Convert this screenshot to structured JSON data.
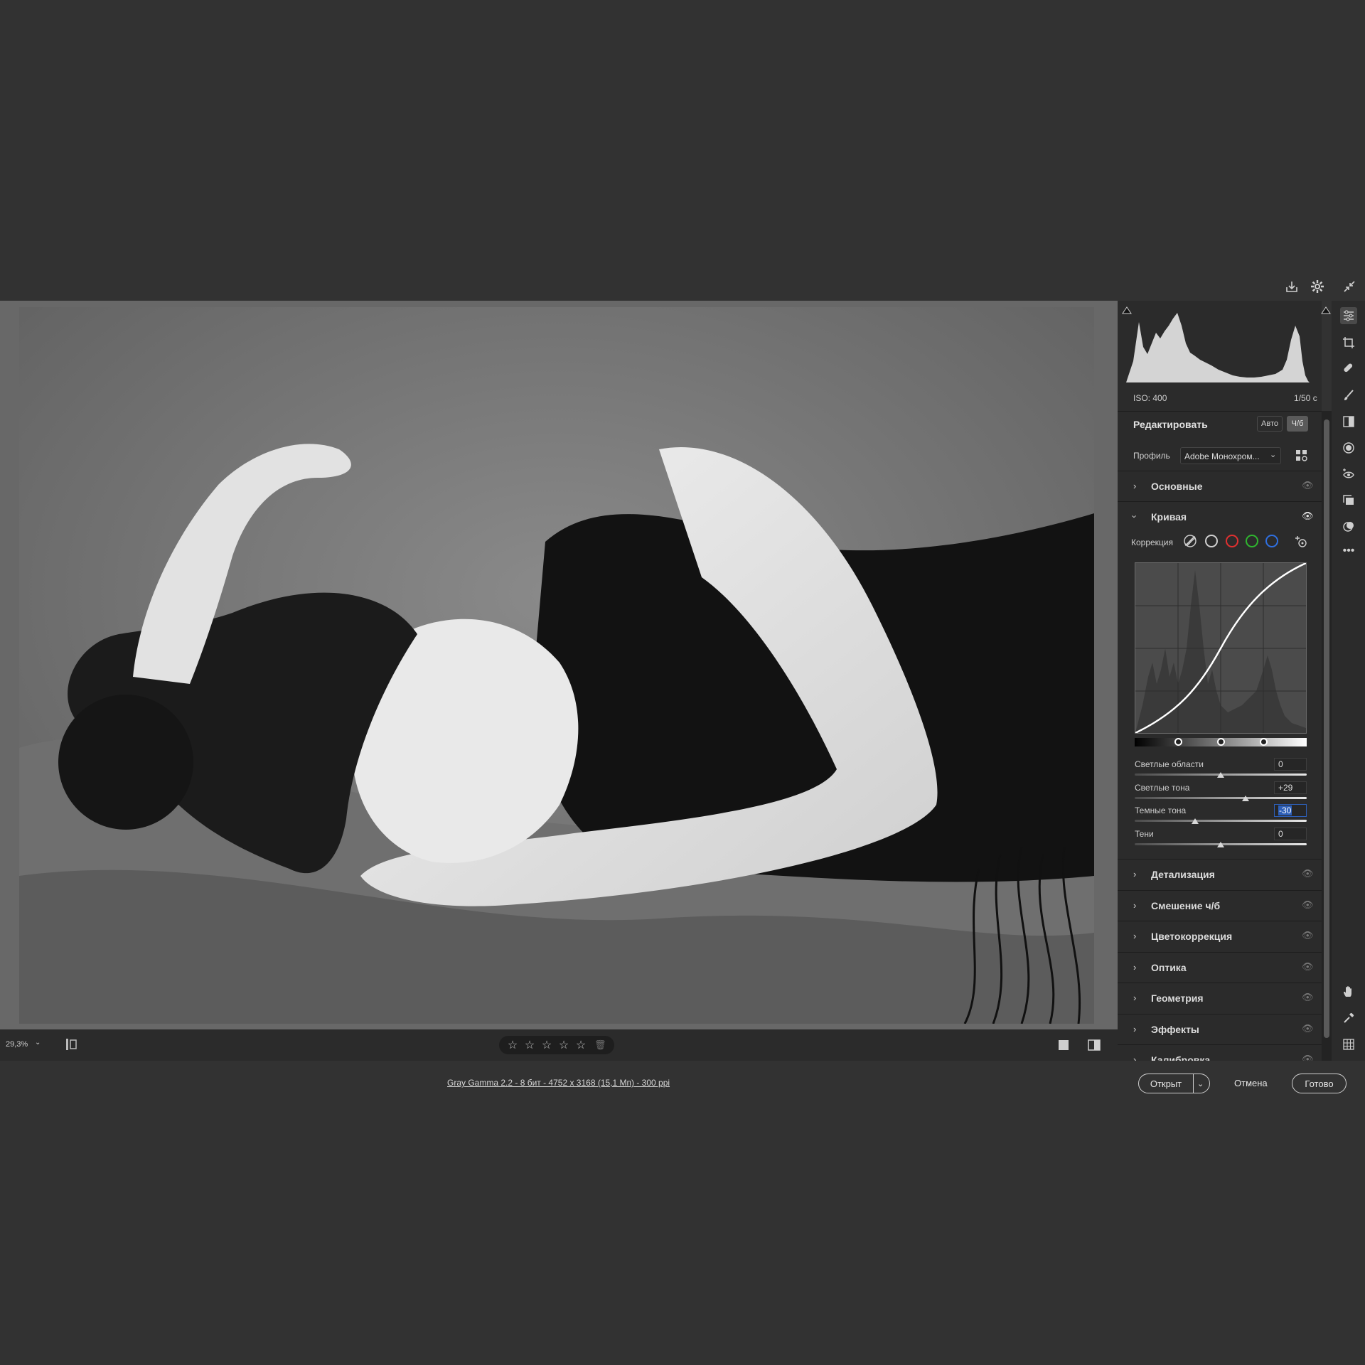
{
  "histogram": {
    "iso": "ISO: 400",
    "shutter": "1/50 с"
  },
  "edit": {
    "title": "Редактировать",
    "auto_label": "Авто",
    "bw_label": "Ч/б",
    "profile_label": "Профиль",
    "profile_value": "Adobe Монохром..."
  },
  "sections": {
    "basic": "Основные",
    "curve": "Кривая",
    "detail": "Детализация",
    "mix": "Смешение ч/б",
    "color": "Цветокоррекция",
    "optics": "Оптика",
    "geometry": "Геометрия",
    "effects": "Эффекты",
    "calibration": "Калибровка"
  },
  "curve": {
    "correction_label": "Коррекция",
    "highlights_label": "Светлые области",
    "highlights_value": "0",
    "lights_label": "Светлые тона",
    "lights_value": "+29",
    "darks_label": "Темные тона",
    "darks_value": "-30",
    "shadows_label": "Тени",
    "shadows_value": "0"
  },
  "canvas": {
    "zoom": "29,3%"
  },
  "status": {
    "info": "Gray Gamma 2.2 - 8 бит - 4752 x 3168 (15,1 Мп) - 300 ppi"
  },
  "buttons": {
    "open": "Открыт",
    "cancel": "Отмена",
    "done": "Готово"
  },
  "colors": {
    "accent_red": "#e03030",
    "accent_green": "#2fb52f",
    "accent_blue": "#2f6fe0",
    "selection": "#2d5fb8"
  }
}
